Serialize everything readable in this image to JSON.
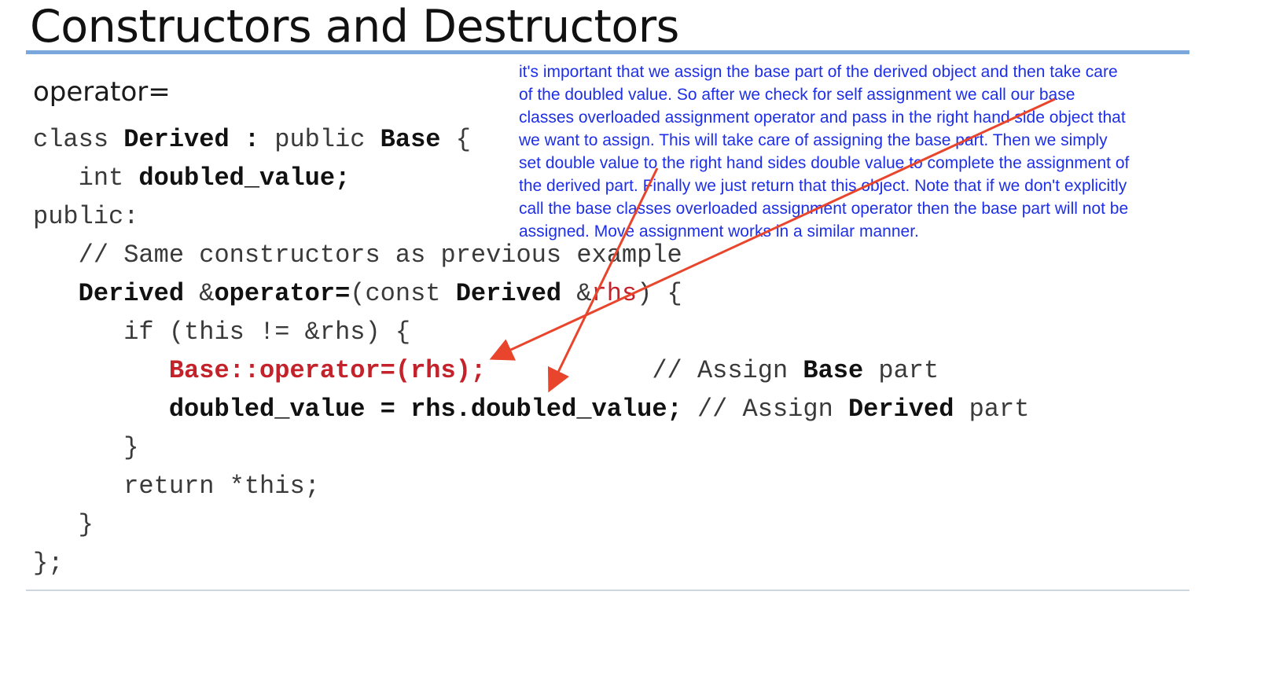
{
  "slide": {
    "title": "Constructors and Destructors",
    "section_heading": "operator="
  },
  "code": {
    "line1": {
      "t1": "class ",
      "t2": "Derived",
      "t3": " : public ",
      "t4": "Base",
      "t5": " {"
    },
    "line2": {
      "t1": "   int ",
      "t2": "doubled_value",
      "t3": ";"
    },
    "line3": "public:",
    "line4": "   // Same constructors as previous example",
    "line5": {
      "t1": "   ",
      "t2": "Derived",
      "t3": " &",
      "t4": "operator=",
      "t5": "(const ",
      "t6": "Derived",
      "t7": " &",
      "t8": "rhs",
      "t9": ") {"
    },
    "line6": "      if (this != &rhs) {",
    "line7": {
      "t1": "         ",
      "t2": "Base::operator=(rhs);",
      "t3": "           // Assign ",
      "t4": "Base",
      "t5": " part"
    },
    "line8": {
      "t1": "         ",
      "t2": "doubled_value = rhs.doubled_value;",
      "t3": " // Assign ",
      "t4": "Derived",
      "t5": " part"
    },
    "line9": "      }",
    "line10": "      return *this;",
    "line11": "   }",
    "line12": "};"
  },
  "annotation": {
    "lines": [
      "it's important that we assign the base part of the derived object and then take care",
      "of the doubled value. So after we check for self assignment we call our base",
      "classes overloaded assignment operator and pass in the right hand side object that",
      "we want to assign. This will take care of assigning the base part. Then we simply",
      "set double value to the right hand sides double value to complete the assignment of",
      "the derived part. Finally we just return that this object. Note that if we don't explicitly",
      "call the base classes overloaded assignment operator then the base part will not be",
      "assigned. Move assignment works in a similar manner."
    ]
  },
  "colors": {
    "title_rule": "#7aa8dc",
    "annotation_text": "#1e2fe6",
    "arrow": "#e8452c",
    "code_highlight": "#c4222a"
  }
}
